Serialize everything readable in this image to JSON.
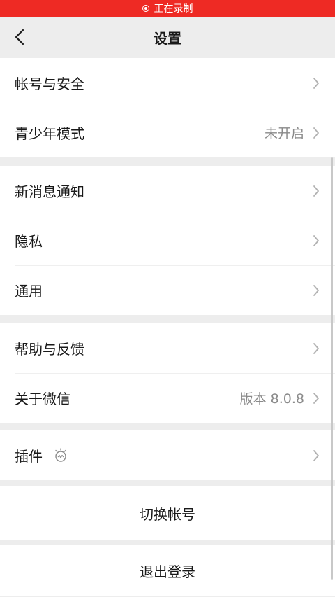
{
  "status_bar": {
    "recording_text": "正在录制"
  },
  "nav": {
    "title": "设置"
  },
  "groups": [
    {
      "items": [
        {
          "label": "帐号与安全",
          "value": ""
        },
        {
          "label": "青少年模式",
          "value": "未开启"
        }
      ]
    },
    {
      "items": [
        {
          "label": "新消息通知",
          "value": ""
        },
        {
          "label": "隐私",
          "value": ""
        },
        {
          "label": "通用",
          "value": ""
        }
      ]
    },
    {
      "items": [
        {
          "label": "帮助与反馈",
          "value": ""
        },
        {
          "label": "关于微信",
          "value": "版本 8.0.8"
        }
      ]
    },
    {
      "items": [
        {
          "label": "插件",
          "value": "",
          "icon": "plugin-bulb-icon"
        }
      ]
    }
  ],
  "actions": {
    "switch_account": "切换帐号",
    "logout": "退出登录"
  },
  "colors": {
    "recording_bar": "#ee2a24",
    "page_background": "#ededed",
    "secondary_text": "#8a8a8a"
  }
}
